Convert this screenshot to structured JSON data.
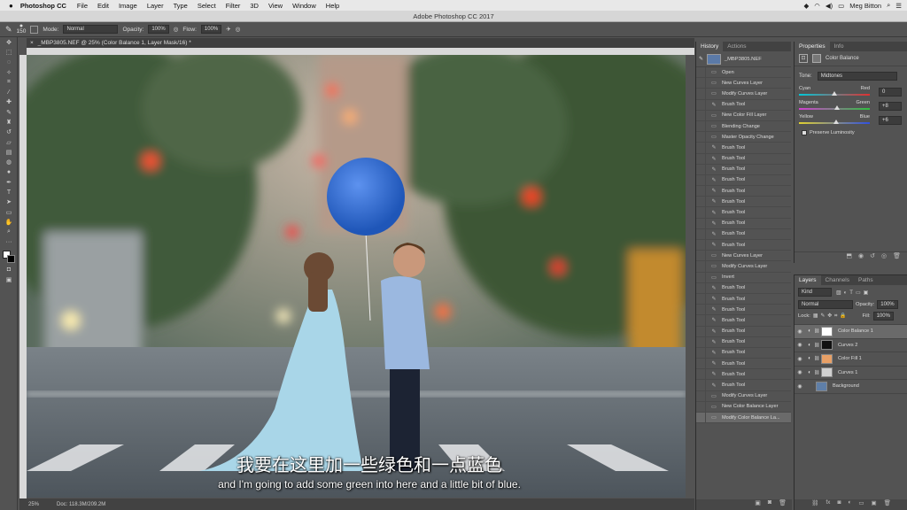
{
  "menubar": {
    "apple": "",
    "app_name": "Photoshop CC",
    "items": [
      "File",
      "Edit",
      "Image",
      "Layer",
      "Type",
      "Select",
      "Filter",
      "3D",
      "View",
      "Window",
      "Help"
    ],
    "user": "Meg Bitton",
    "battery": "100%"
  },
  "titlebar": {
    "title": "Adobe Photoshop CC 2017"
  },
  "options": {
    "mode_label": "Mode:",
    "mode_value": "Normal",
    "opacity_label": "Opacity:",
    "opacity_value": "100%",
    "flow_label": "Flow:",
    "flow_value": "100%",
    "brush_size": "150"
  },
  "document": {
    "tab": "_MBP3805.NEF @ 25% (Color Balance 1, Layer Mask/16) *",
    "zoom": "25%",
    "doc_size": "Doc: 118.3M/209.2M"
  },
  "history": {
    "tabs": [
      "History",
      "Actions"
    ],
    "snapshot": "_MBP3805.NEF",
    "items": [
      "Open",
      "New Curves Layer",
      "Modify Curves Layer",
      "Brush Tool",
      "New Color Fill Layer",
      "Blending Change",
      "Master Opacity Change",
      "Brush Tool",
      "Brush Tool",
      "Brush Tool",
      "Brush Tool",
      "Brush Tool",
      "Brush Tool",
      "Brush Tool",
      "Brush Tool",
      "Brush Tool",
      "Brush Tool",
      "New Curves Layer",
      "Modify Curves Layer",
      "Invert",
      "Brush Tool",
      "Brush Tool",
      "Brush Tool",
      "Brush Tool",
      "Brush Tool",
      "Brush Tool",
      "Brush Tool",
      "Brush Tool",
      "Brush Tool",
      "Brush Tool",
      "Modify Curves Layer",
      "New Color Balance Layer",
      "Modify Color Balance La..."
    ]
  },
  "properties": {
    "tabs": [
      "Properties",
      "Info"
    ],
    "panel_title": "Color Balance",
    "tone_label": "Tone:",
    "tone_value": "Midtones",
    "sliders": [
      {
        "left": "Cyan",
        "right": "Red",
        "value": "0",
        "level": 0.5
      },
      {
        "left": "Magenta",
        "right": "Green",
        "value": "+8",
        "level": 0.54
      },
      {
        "left": "Yellow",
        "right": "Blue",
        "value": "+6",
        "level": 0.53
      }
    ],
    "preserve_label": "Preserve Luminosity"
  },
  "layers": {
    "tabs": [
      "Layers",
      "Channels",
      "Paths"
    ],
    "kind": "Kind",
    "blend": "Normal",
    "opacity_label": "Opacity:",
    "opacity_value": "100%",
    "lock_label": "Lock:",
    "fill_label": "Fill:",
    "fill_value": "100%",
    "items": [
      {
        "name": "Color Balance 1",
        "selected": true
      },
      {
        "name": "Curves 2",
        "selected": false
      },
      {
        "name": "Color Fill 1",
        "selected": false
      },
      {
        "name": "Curves 1",
        "selected": false
      },
      {
        "name": "Background",
        "selected": false
      }
    ]
  },
  "subtitles": {
    "chinese": "我要在这里加一些绿色和一点蓝色",
    "english": "and I'm going to add some green into here and a little bit of blue."
  },
  "colors": {
    "balloon": "#2f6fd6",
    "accent": "#6a6a6a"
  }
}
